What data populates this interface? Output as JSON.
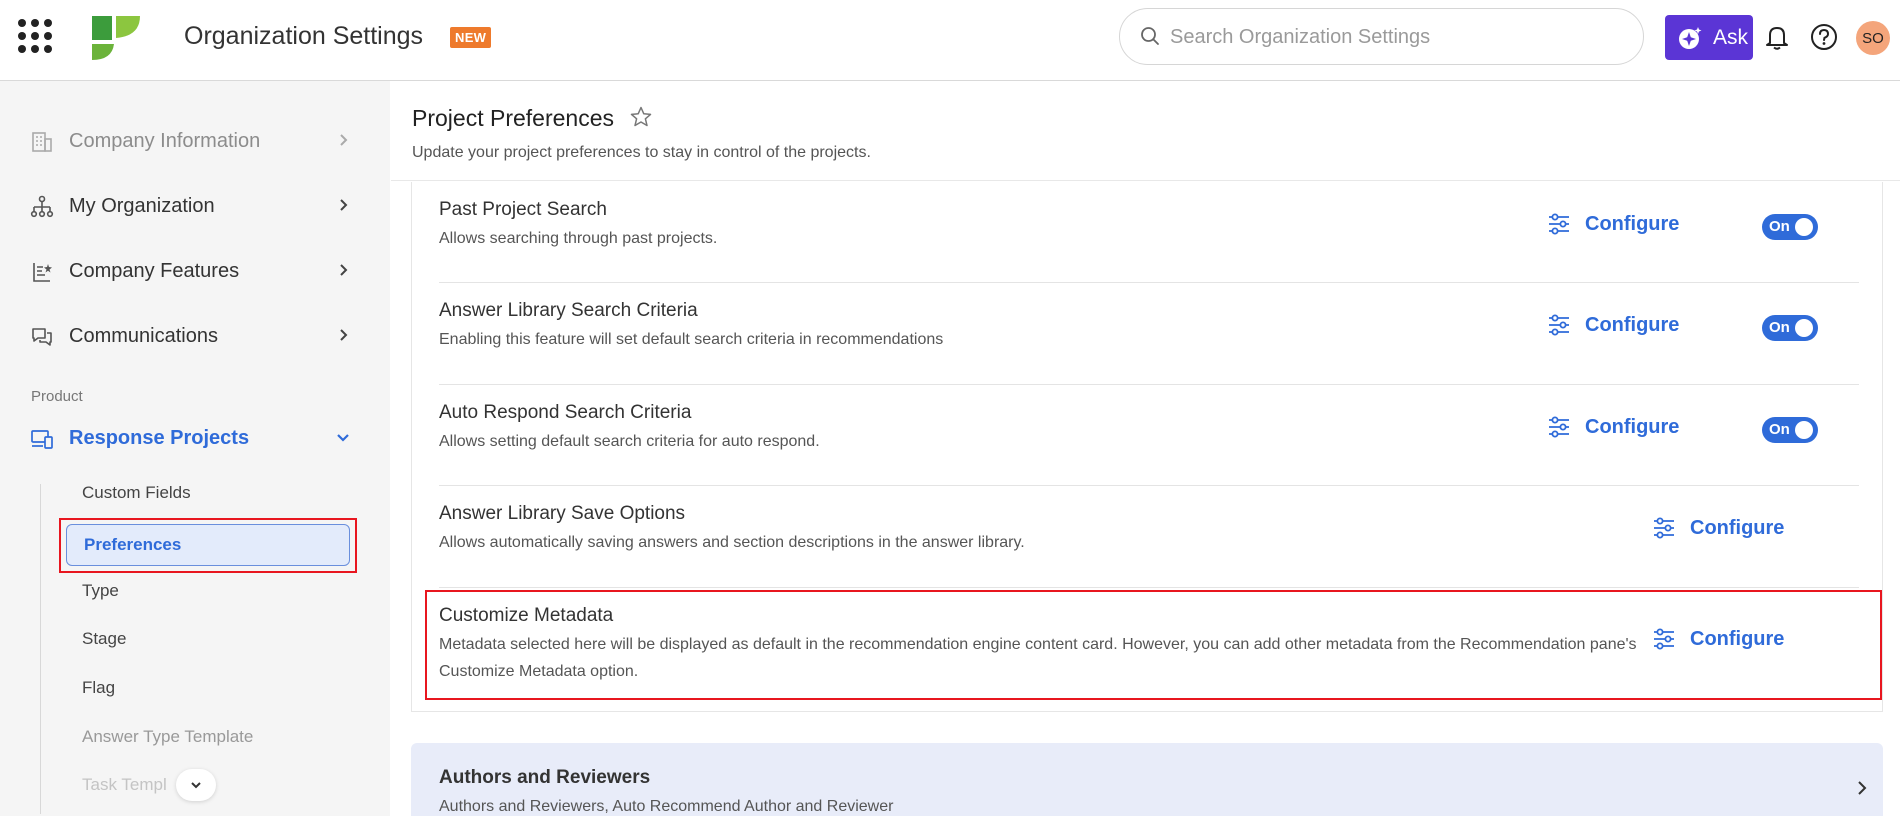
{
  "header": {
    "title": "Organization Settings",
    "badge": "NEW",
    "search_placeholder": "Search Organization Settings",
    "ask_label": "Ask",
    "avatar_initials": "SO"
  },
  "sidebar": {
    "items": [
      {
        "label": "Company Information",
        "icon": "building-icon"
      },
      {
        "label": "My Organization",
        "icon": "org-chart-icon"
      },
      {
        "label": "Company Features",
        "icon": "features-icon"
      },
      {
        "label": "Communications",
        "icon": "chat-bubbles-icon"
      }
    ],
    "section_label": "Product",
    "active_group": {
      "label": "Response Projects",
      "icon": "devices-icon"
    },
    "sub_items": [
      "Custom Fields",
      "Preferences",
      "Type",
      "Stage",
      "Flag",
      "Answer Type Template",
      "Task Templ"
    ]
  },
  "main": {
    "title": "Project Preferences",
    "subtitle": "Update your project preferences to stay in control of the projects.",
    "configure_label": "Configure",
    "toggle_label": "On",
    "features": [
      {
        "title": "Past Project Search",
        "description": "Allows searching through past projects.",
        "toggle": "On"
      },
      {
        "title": "Answer Library Search Criteria",
        "description": "Enabling this feature will set default search criteria in recommendations",
        "toggle": "On"
      },
      {
        "title": "Auto Respond Search Criteria",
        "description": "Allows setting default search criteria for auto respond.",
        "toggle": "On"
      },
      {
        "title": "Answer Library Save Options",
        "description": "Allows automatically saving answers and section descriptions in the answer library."
      },
      {
        "title": "Customize Metadata",
        "description": "Metadata selected here will be displayed as default in the recommendation engine content card. However, you can add other metadata from the Recommendation pane's Customize Metadata option."
      }
    ],
    "authors_card": {
      "title": "Authors and Reviewers",
      "description": "Authors and Reviewers, Auto Recommend Author and Reviewer"
    }
  },
  "colors": {
    "accent": "#2f6bd9",
    "ask_button": "#5b35d5",
    "new_badge": "#ee7a2c",
    "highlight": "#e8161f",
    "avatar": "#f4a57b"
  }
}
